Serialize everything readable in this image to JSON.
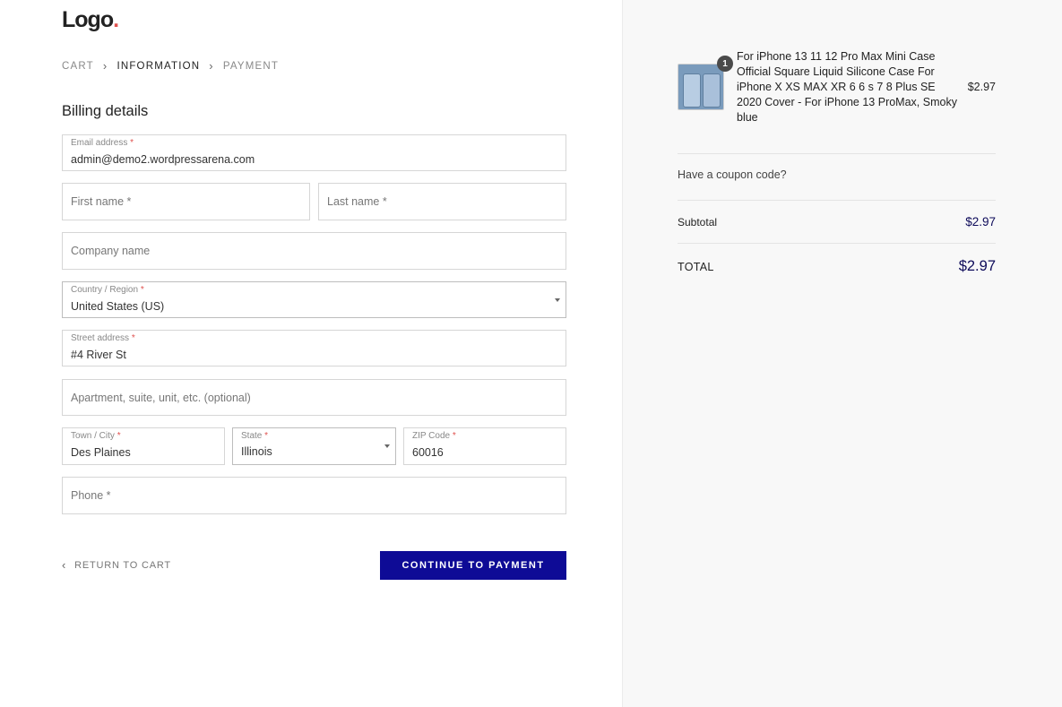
{
  "brand": {
    "logo_text": "Logo",
    "logo_dot": ".",
    "accent": "#e0524f",
    "primary": "#0e0b96"
  },
  "breadcrumb": {
    "items": [
      "CART",
      "INFORMATION",
      "PAYMENT"
    ],
    "separator": "›",
    "active": "INFORMATION"
  },
  "billing": {
    "title": "Billing details",
    "email": {
      "label": "Email address",
      "required": "*",
      "value": "admin@demo2.wordpressarena.com"
    },
    "first_name": {
      "placeholder": "First name *"
    },
    "last_name": {
      "placeholder": "Last name *"
    },
    "company": {
      "placeholder": "Company name"
    },
    "country": {
      "label": "Country / Region",
      "required": "*",
      "value": "United States (US)"
    },
    "street": {
      "label": "Street address",
      "required": "*",
      "value": "#4 River St"
    },
    "apartment": {
      "placeholder": "Apartment, suite, unit, etc. (optional)"
    },
    "city": {
      "label": "Town / City",
      "required": "*",
      "value": "Des Plaines"
    },
    "state": {
      "label": "State",
      "required": "*",
      "value": "Illinois"
    },
    "zip": {
      "label": "ZIP Code",
      "required": "*",
      "value": "60016"
    },
    "phone": {
      "placeholder": "Phone *"
    }
  },
  "actions": {
    "return_label": "RETURN TO CART",
    "continue_label": "CONTINUE TO PAYMENT"
  },
  "order": {
    "item": {
      "quantity": "1",
      "name": "For iPhone 13 11 12 Pro Max Mini Case Official Square Liquid Silicone Case For iPhone X XS MAX XR 6 6 s 7 8 Plus SE 2020 Cover - For iPhone 13 ProMax, Smoky blue",
      "price": "$2.97"
    },
    "coupon_text": "Have a coupon code?",
    "subtotal_label": "Subtotal",
    "subtotal_value": "$2.97",
    "total_label": "TOTAL",
    "total_value": "$2.97"
  }
}
